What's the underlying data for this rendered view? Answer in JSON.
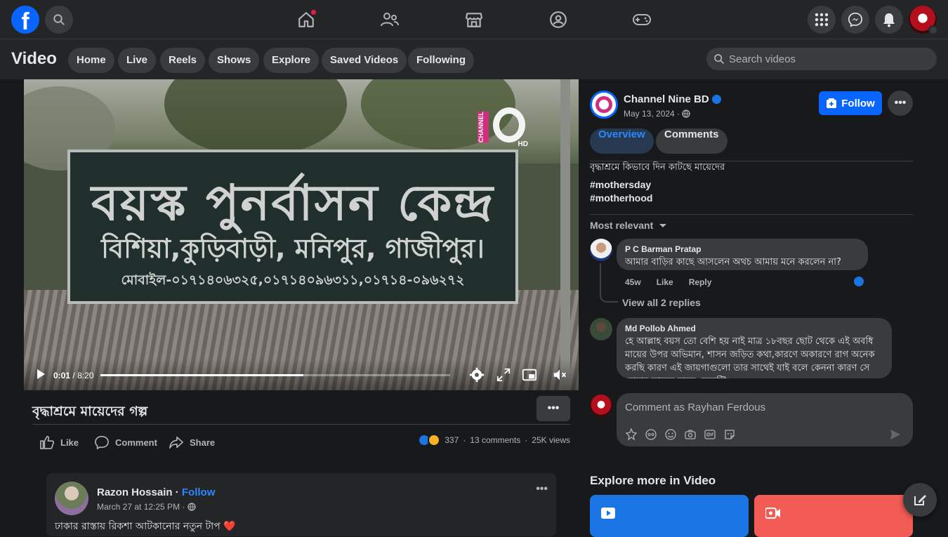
{
  "topbar": {
    "logo": "f",
    "search_icon": "search-icon",
    "nav": [
      "home-icon",
      "friends-icon",
      "marketplace-icon",
      "groups-icon",
      "gaming-icon"
    ],
    "right_icons": [
      "menu-grid-icon",
      "messenger-icon",
      "notifications-icon"
    ]
  },
  "subbar": {
    "title": "Video",
    "tabs": [
      "Home",
      "Live",
      "Reels",
      "Shows",
      "Explore",
      "Saved Videos",
      "Following"
    ],
    "search_placeholder": "Search videos"
  },
  "video": {
    "sign_line1": "বয়স্ক পুনর্বাসন কেন্দ্র",
    "sign_line2": "বিশিয়া,কুড়িবাড়ী, মনিপুর, গাজীপুর।",
    "sign_line3": "মোবাইল-০১৭১৪০৬৩২৫,০১৭১৪০৯৬৩১১,০১৭১৪-০৯৬২৭২",
    "channel_logo": "CHANNEL",
    "channel_hd": "HD",
    "current_time": "0:01",
    "separator": "/",
    "duration": "8:20",
    "progress": 0.58
  },
  "post": {
    "title": "বৃদ্ধাশ্রমে মায়েদের গল্প",
    "more": "•••",
    "actions": [
      "Like",
      "Comment",
      "Share"
    ],
    "reactions_count": "337",
    "comments_count": "13 comments",
    "views": "25K views",
    "dot": "·"
  },
  "side": {
    "page_name": "Channel Nine BD",
    "date": "May 13, 2024 ·",
    "follow_label": "Follow",
    "more": "•••",
    "tabs": [
      "Overview",
      "Comments"
    ],
    "description": "বৃদ্ধাশ্রমে কিভাবে দিন কাটছে মায়েদের",
    "hashtags": [
      "#mothersday",
      "#motherhood"
    ],
    "sort_label": "Most relevant",
    "comments": [
      {
        "name": "P C Barman Pratap",
        "text": "আমার বাড়ির কাছে আসলেন অথচ আমায় মনে করলেন না?",
        "time": "45w",
        "like": "Like",
        "reply": "Reply"
      },
      {
        "name": "Md Pollob Ahmed",
        "text": "হে আল্লাহ বয়স তো বেশি হয় নাই মাত্র ১৮বছর ছোট থেকে এই অবধি মায়ের উপর অভিমান, শাসন জড়িত কথা,কারণে অকারণে রাগ অনেক করছি কারণ এই জায়গাগুলো তার সাথেই যাই বলে কেননা কারণ সে আমার কাছের মানুষ নেবেন্টি।"
      }
    ],
    "view_replies": "View all 2 replies",
    "compose_placeholder": "Comment as Rayhan Ferdous"
  },
  "feed": {
    "name": "Razon Hossain",
    "dot": " · ",
    "follow": "Follow",
    "date": "March 27 at 12:25 PM ·",
    "text": "ঢাকার রাস্তায় রিকশা আটকানোর নতুন টাপ ❤️",
    "more": "•••"
  },
  "explore": {
    "title": "Explore more in Video"
  },
  "colors": {
    "accent": "#0866ff",
    "link": "#2d88ff",
    "background": "#18191a",
    "surface": "#242526",
    "button": "#3a3b3c"
  }
}
